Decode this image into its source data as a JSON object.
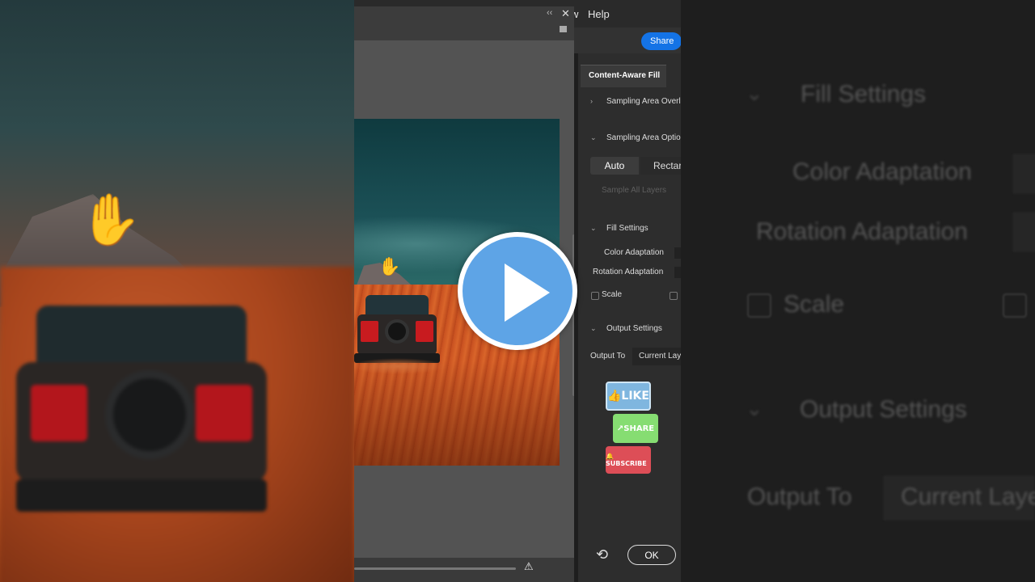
{
  "menu": {
    "window_partial": "w",
    "help": "Help"
  },
  "header": {
    "share_label": "Share"
  },
  "panel": {
    "tab_title": "Content-Aware Fill",
    "sampling_overlay": "Sampling Area Overl",
    "sampling_options": "Sampling Area Optio",
    "auto_label": "Auto",
    "rect_label": "Rectar",
    "sample_all_layers": "Sample All Layers",
    "fill_settings": "Fill Settings",
    "color_adaptation": "Color Adaptation",
    "rotation_adaptation": "Rotation Adaptation",
    "scale": "Scale",
    "output_settings": "Output Settings",
    "output_to": "Output To",
    "output_value": "Current Lay",
    "ok_label": "OK"
  },
  "stickers": {
    "like": "👍LIKE",
    "share": "↗SHARE",
    "subscribe": "🔔SUBSCRIBE"
  },
  "backdrop_right": {
    "fill_settings": "Fill Settings",
    "color_adaptation": "Color Adaptation",
    "rotation_adaptation": "Rotation Adaptation",
    "scale": "Scale",
    "output_settings": "Output Settings",
    "output_to": "Output To",
    "output_value": "Current Laye"
  },
  "icons": {
    "play": "play-icon",
    "hand": "hand-tool-icon",
    "reset": "reset-icon",
    "warning": "warning-icon"
  },
  "colors": {
    "accent": "#1473e6",
    "play": "#5ea4e6",
    "like": "#7fb6df",
    "share": "#86dd72",
    "subscribe": "#dd4e57"
  }
}
